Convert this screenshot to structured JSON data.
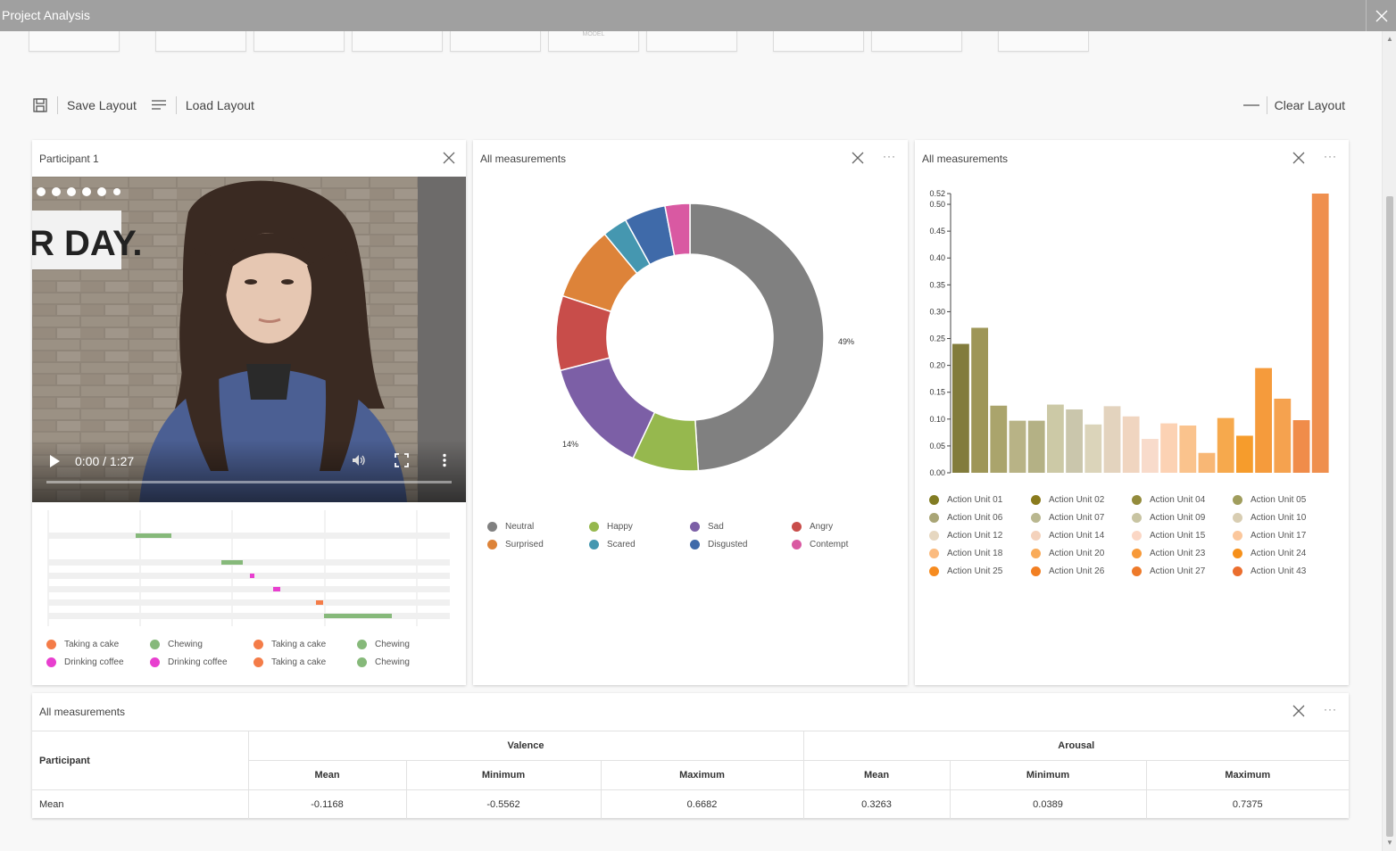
{
  "window": {
    "title": "Project Analysis"
  },
  "top_strip": {
    "model_label": "MODEL"
  },
  "toolbar": {
    "save_label": "Save Layout",
    "load_label": "Load Layout",
    "clear_label": "Clear Layout"
  },
  "video_panel": {
    "title": "Participant 1",
    "time_display": "0:00 / 1:27",
    "sign_text": "R DAY.",
    "timeline_legend": [
      {
        "label": "Taking a cake",
        "color": "#f47c48"
      },
      {
        "label": "Chewing",
        "color": "#86b97a"
      },
      {
        "label": "Taking a cake",
        "color": "#f47c48"
      },
      {
        "label": "Chewing",
        "color": "#86b97a"
      },
      {
        "label": "Drinking coffee",
        "color": "#e83fcf"
      },
      {
        "label": "Drinking coffee",
        "color": "#e83fcf"
      },
      {
        "label": "Taking a cake",
        "color": "#f47c48"
      },
      {
        "label": "Chewing",
        "color": "#86b97a"
      }
    ]
  },
  "pie_panel": {
    "title": "All measurements",
    "label_large": "49%",
    "label_small": "14%",
    "legend": [
      {
        "label": "Neutral",
        "color": "#808080"
      },
      {
        "label": "Happy",
        "color": "#96b84e"
      },
      {
        "label": "Sad",
        "color": "#7c5fa6"
      },
      {
        "label": "Angry",
        "color": "#c84d4a"
      },
      {
        "label": "Surprised",
        "color": "#dd8339"
      },
      {
        "label": "Scared",
        "color": "#4597b0"
      },
      {
        "label": "Disgusted",
        "color": "#3f6aa9"
      },
      {
        "label": "Contempt",
        "color": "#d959a2"
      }
    ]
  },
  "bar_panel": {
    "title": "All measurements"
  },
  "table_panel": {
    "title": "All measurements",
    "participant_header": "Participant",
    "groups": [
      "Valence",
      "Arousal"
    ],
    "subheaders": [
      "Mean",
      "Minimum",
      "Maximum",
      "Mean",
      "Minimum",
      "Maximum"
    ],
    "rows": [
      {
        "label": "Mean",
        "values": [
          "-0.1168",
          "-0.5562",
          "0.6682",
          "0.3263",
          "0.0389",
          "0.7375"
        ]
      }
    ]
  },
  "chart_data": [
    {
      "type": "pie",
      "title": "",
      "categories": [
        "Neutral",
        "Happy",
        "Sad",
        "Angry",
        "Surprised",
        "Scared",
        "Disgusted",
        "Contempt"
      ],
      "values": [
        49,
        8,
        14,
        9,
        9,
        3,
        5,
        3
      ],
      "colors": [
        "#808080",
        "#96b84e",
        "#7c5fa6",
        "#c84d4a",
        "#dd8339",
        "#4597b0",
        "#3f6aa9",
        "#d959a2"
      ],
      "data_labels": {
        "Neutral": "49%",
        "Sad": "14%"
      },
      "donut": true,
      "legend_position": "bottom"
    },
    {
      "type": "bar",
      "title": "",
      "categories": [
        "Action Unit 01",
        "Action Unit 02",
        "Action Unit 04",
        "Action Unit 05",
        "Action Unit 06",
        "Action Unit 07",
        "Action Unit 09",
        "Action Unit 10",
        "Action Unit 12",
        "Action Unit 14",
        "Action Unit 15",
        "Action Unit 17",
        "Action Unit 18",
        "Action Unit 20",
        "Action Unit 23",
        "Action Unit 24",
        "Action Unit 25",
        "Action Unit 26",
        "Action Unit 27",
        "Action Unit 43"
      ],
      "values": [
        0.24,
        0.27,
        0.125,
        0.097,
        0.097,
        0.127,
        0.118,
        0.09,
        0.124,
        0.105,
        0.063,
        0.092,
        0.088,
        0.037,
        0.102,
        0.069,
        0.195,
        0.138,
        0.098,
        0.52
      ],
      "colors": [
        "#827c3c",
        "#9e9657",
        "#aaa46c",
        "#b8b386",
        "#b4b185",
        "#ccc9a6",
        "#cac6ac",
        "#dbd4ba",
        "#e3d3be",
        "#f0d5c0",
        "#f8dbcb",
        "#fcd2b4",
        "#fac38d",
        "#f8b775",
        "#f6a94d",
        "#f69c2c",
        "#f59b3c",
        "#f5a24f",
        "#f08c4a",
        "#ef8f4e"
      ],
      "yticks": [
        "0.00",
        "0.05",
        "0.10",
        "0.15",
        "0.20",
        "0.25",
        "0.30",
        "0.35",
        "0.40",
        "0.45",
        "0.50",
        "0.52"
      ],
      "ylim": [
        0,
        0.52
      ],
      "legend_position": "bottom",
      "legend_colors": [
        "#827c23",
        "#8a7b1d",
        "#938b3c",
        "#a09d5d",
        "#a9a576",
        "#b9b78f",
        "#c8c4a2",
        "#d8cdb2",
        "#e6d7c0",
        "#f4d2bc",
        "#fbd7c5",
        "#fbc79c",
        "#fbbb7f",
        "#f9ab59",
        "#f79938",
        "#f6901a",
        "#f68b1f",
        "#f27f22",
        "#ee7a2a",
        "#eb6e2e"
      ]
    }
  ]
}
